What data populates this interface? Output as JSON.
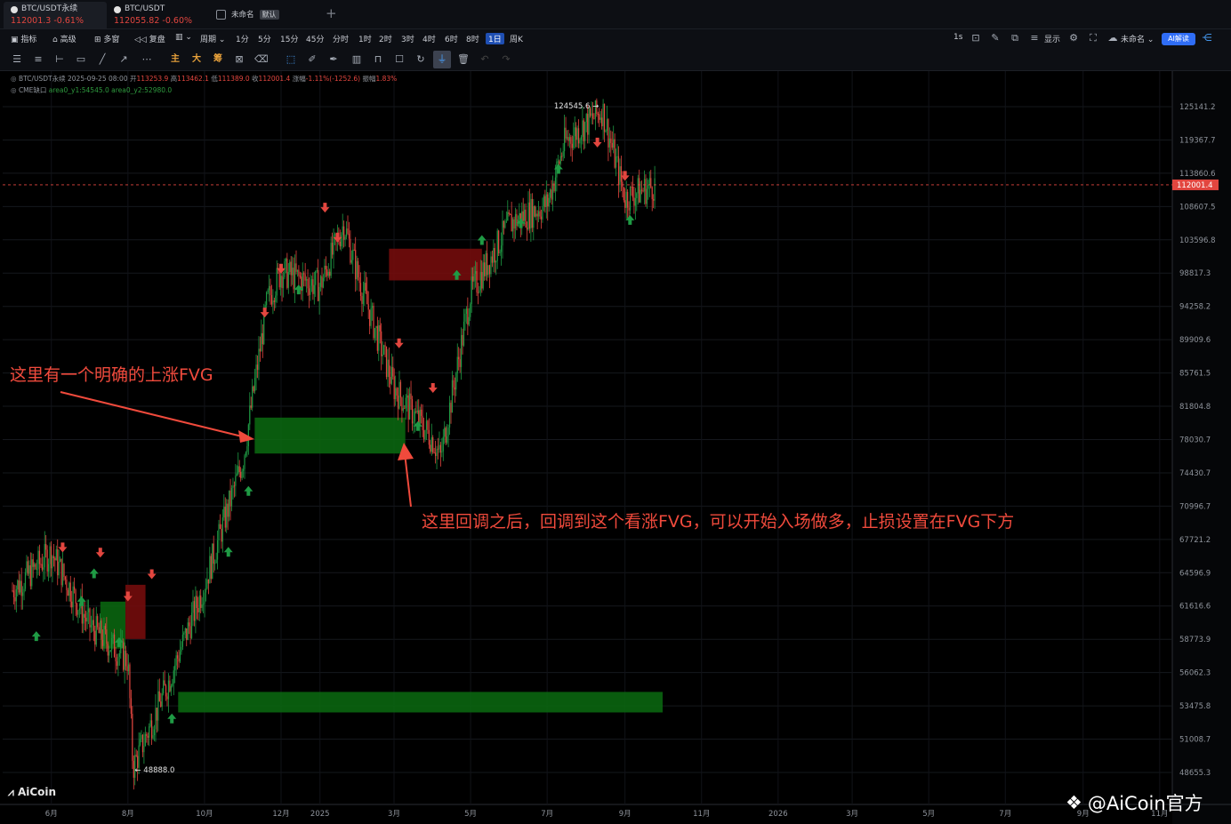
{
  "tabs": [
    {
      "name": "BTC/USDT永续",
      "price": "112001.3",
      "change": "-0.61%",
      "active": true
    },
    {
      "name": "BTC/USDT",
      "price": "112055.82",
      "change": "-0.60%",
      "active": false
    }
  ],
  "template_tab": {
    "name": "未命名",
    "badge": "默认"
  },
  "toolbar": {
    "left_items": [
      "指标",
      "高级",
      "多窗",
      "复盘",
      "周期"
    ],
    "periods": [
      "1分",
      "5分",
      "15分",
      "45分",
      "分时",
      "1时",
      "2时",
      "3时",
      "4时",
      "6时",
      "8时",
      "1日",
      "周K"
    ],
    "active_period": "1日",
    "right_items": [
      "1s",
      "显示",
      "未命名"
    ],
    "ai_label": "AI解读"
  },
  "drawing_tools": {
    "main_label": "主",
    "big_label": "大",
    "chip_label": "筹"
  },
  "info": {
    "line1_symbol": "BTC/USDT永续",
    "line1_date": "2025-09-25 08:00",
    "open_label": "开",
    "open": "113253.9",
    "high_label": "高",
    "high": "113462.1",
    "low_label": "低",
    "low": "111389.0",
    "close_label": "收",
    "close": "112001.4",
    "change_label": "涨幅",
    "change": "-1.11%(-1252.6)",
    "amp_label": "振幅",
    "amp": "1.83%",
    "line2_name": "CME缺口",
    "line2_v1": "area0_y1:54545.0",
    "line2_v2": "area0_y2:52980.0"
  },
  "price_axis": [
    "125141.2",
    "119367.7",
    "113860.6",
    "108607.5",
    "103596.8",
    "98817.3",
    "94258.2",
    "89909.6",
    "85761.5",
    "81804.8",
    "78030.7",
    "74430.7",
    "70996.7",
    "67721.2",
    "64596.9",
    "61616.6",
    "58773.9",
    "56062.3",
    "53475.8",
    "51008.7",
    "48655.3"
  ],
  "current_price": "112001.4",
  "time_axis": [
    "6月",
    "8月",
    "10月",
    "12月",
    "2025",
    "3月",
    "5月",
    "7月",
    "9月",
    "11月",
    "2026",
    "3月",
    "5月",
    "7月",
    "9月",
    "11月"
  ],
  "high_marker": "124545.6",
  "low_marker": "48888.0",
  "annotations": {
    "note1": "这里有一个明确的上涨FVG",
    "note2": "这里回调之后，回调到这个看涨FVG，可以开始入场做多，止损设置在FVG下方"
  },
  "logo": "AiCoin",
  "watermark": "@AiCoin官方",
  "colors": {
    "up": "#1f9a44",
    "down": "#e2463f",
    "bull_fvg": "#0b6b11",
    "bear_fvg": "#7a0d0d",
    "accent": "#2f6df6"
  },
  "chart_data": {
    "type": "candlestick",
    "symbol": "BTC/USDT永续",
    "timeframe": "1日",
    "ylim": [
      48655.3,
      125141.2
    ],
    "price_scale": "log",
    "close_path": [
      [
        "2024-05",
        63000
      ],
      [
        "2024-06",
        66500
      ],
      [
        "2024-07",
        60000
      ],
      [
        "2024-08",
        57000
      ],
      [
        "2024-08-05",
        49000
      ],
      [
        "2024-09",
        55000
      ],
      [
        "2024-10",
        63500
      ],
      [
        "2024-11",
        76000
      ],
      [
        "2024-11-20",
        95000
      ],
      [
        "2024-12",
        99000
      ],
      [
        "2025-01",
        97000
      ],
      [
        "2025-01-20",
        106000
      ],
      [
        "2025-02",
        98000
      ],
      [
        "2025-03",
        84000
      ],
      [
        "2025-04",
        78000
      ],
      [
        "2025-04-07",
        76000
      ],
      [
        "2025-05",
        96000
      ],
      [
        "2025-06",
        106000
      ],
      [
        "2025-07",
        109000
      ],
      [
        "2025-07-15",
        119000
      ],
      [
        "2025-08-14",
        124545.6
      ],
      [
        "2025-09",
        110000
      ],
      [
        "2025-09-25",
        112001.4
      ]
    ],
    "zones": [
      {
        "kind": "bullish FVG",
        "from": "2024-11-10",
        "to": "2025-03-10",
        "low": 76500,
        "high": 80500
      },
      {
        "kind": "bearish FVG",
        "from": "2025-02-25",
        "to": "2025-05-10",
        "low": 97800,
        "high": 102300
      },
      {
        "kind": "CME gap",
        "from": "2024-09-10",
        "to": "2025-10-01",
        "low": 52980,
        "high": 54545
      },
      {
        "kind": "bullish FVG",
        "from": "2024-07-10",
        "to": "2024-07-30",
        "low": 58000,
        "high": 62000
      },
      {
        "kind": "bearish FVG",
        "from": "2024-07-30",
        "to": "2024-08-15",
        "low": 58800,
        "high": 63500
      }
    ]
  }
}
